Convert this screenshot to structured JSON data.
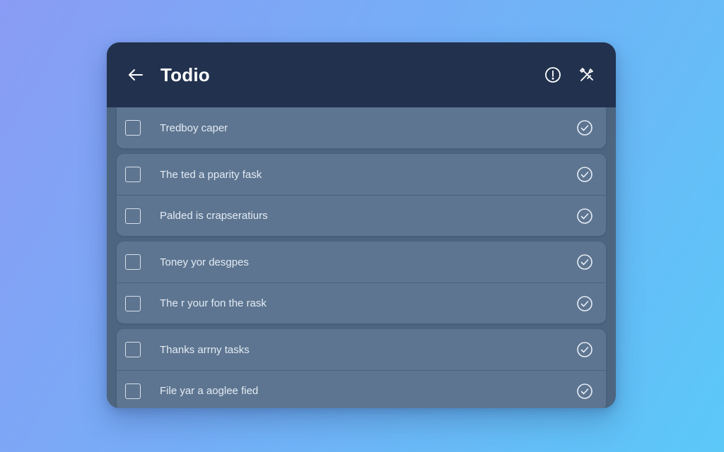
{
  "header": {
    "title": "Todio",
    "back_icon": "arrow-left-icon",
    "info_icon": "info-icon",
    "action_icon": "tools-icon"
  },
  "colors": {
    "header_bg": "#22324e",
    "panel_bg": "#4e6580",
    "row_bg": "#5d7590",
    "text": "#e4ebf5"
  },
  "tasks": [
    {
      "text": "Tredboy caper",
      "group": 1
    },
    {
      "text": "The ted a pparity fask",
      "group": 2
    },
    {
      "text": "Palded is crapseratiurs",
      "group": 2
    },
    {
      "text": "Toney yor desgpes",
      "group": 3
    },
    {
      "text": "The r your fon the rask",
      "group": 3
    },
    {
      "text": "Thanks arrny tasks",
      "group": 4
    },
    {
      "text": "File yar a aoglee fied",
      "group": 4
    }
  ]
}
